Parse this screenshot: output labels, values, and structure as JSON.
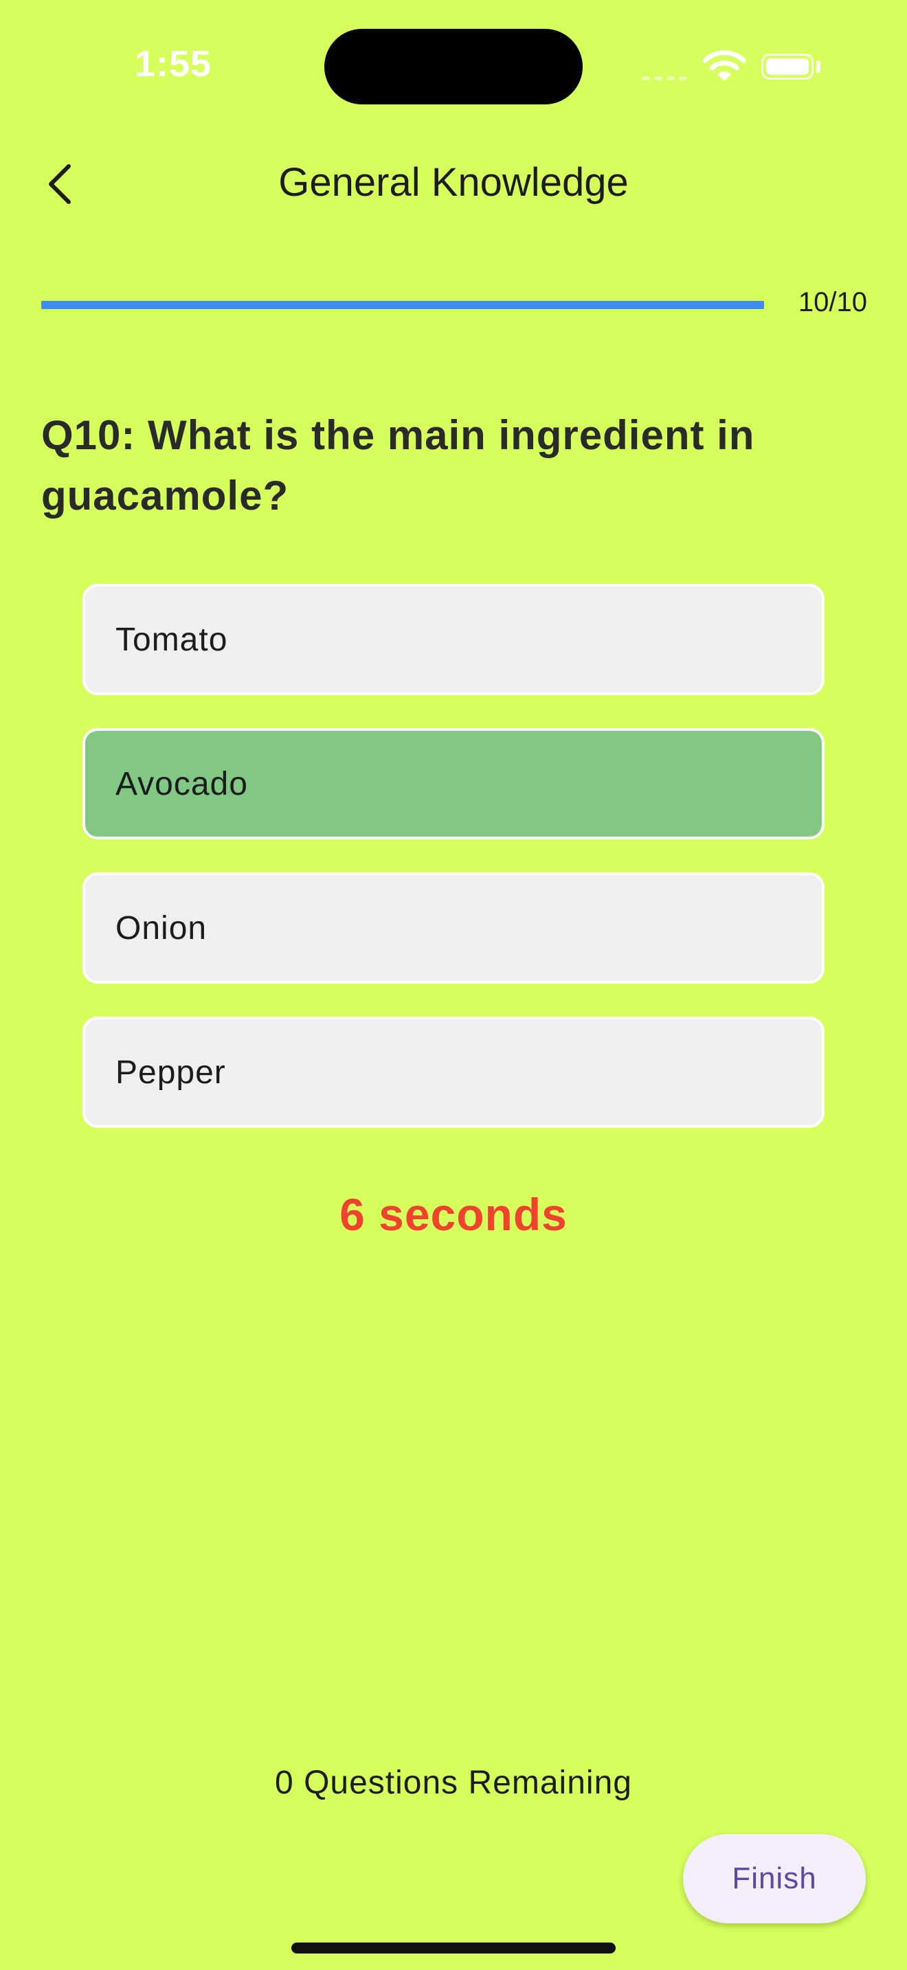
{
  "status_bar": {
    "time": "1:55",
    "icons": [
      "signal-icon",
      "wifi-icon",
      "battery-icon"
    ]
  },
  "app_bar": {
    "back_icon": "chevron-left-icon",
    "title": "General Knowledge"
  },
  "progress": {
    "label": "10/10",
    "fraction": 1.0,
    "color": "#3f8cf0"
  },
  "question": {
    "text": "Q10: What is the main ingredient in guacamole?"
  },
  "answers": [
    {
      "label": "Tomato",
      "state": "default"
    },
    {
      "label": "Avocado",
      "state": "correct"
    },
    {
      "label": "Onion",
      "state": "default"
    },
    {
      "label": "Pepper",
      "state": "default"
    }
  ],
  "timer": {
    "text": "6 seconds",
    "color": "#f0432f"
  },
  "footer": {
    "remaining_text": "0 Questions Remaining",
    "finish_label": "Finish"
  },
  "colors": {
    "background": "#d6ff5c",
    "answer_default": "#efefef",
    "answer_correct": "#80c883",
    "finish_text": "#5e45a8"
  }
}
